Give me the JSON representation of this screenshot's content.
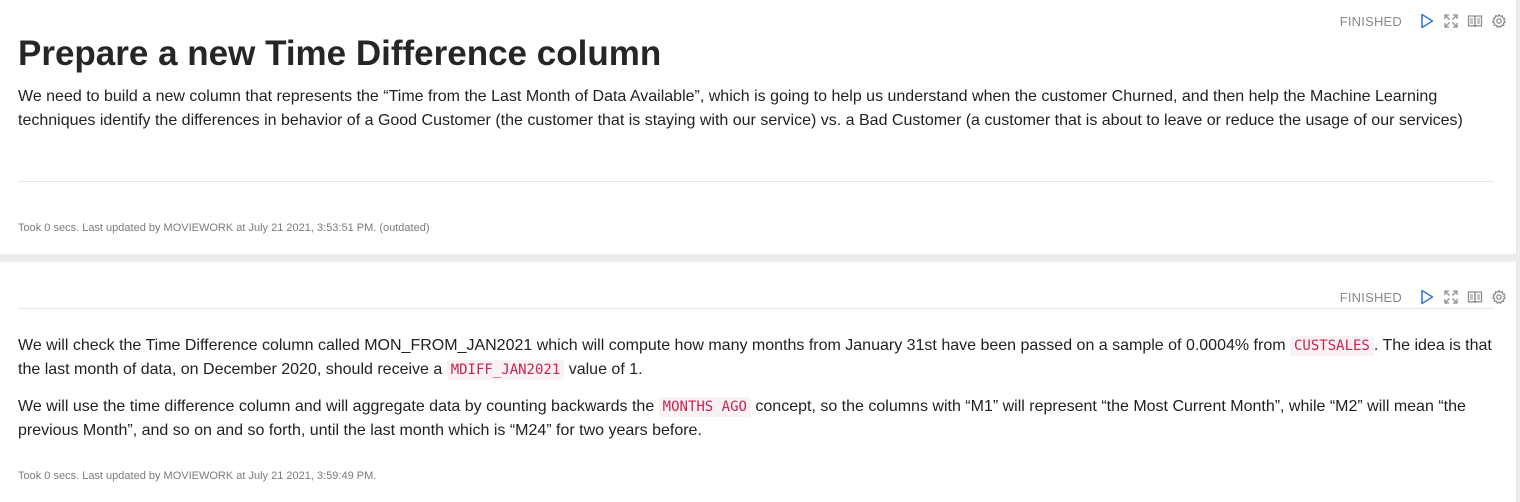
{
  "paragraph1": {
    "status": "FINISHED",
    "title": "Prepare a new Time Difference column",
    "text": "We need to build a new column that represents the “Time from the Last Month of Data Available”, which is going to help us understand when the customer Churned, and then help the Machine Learning techniques identify the differences in behavior of a Good Customer (the customer that is staying with our service) vs. a Bad Customer (a customer that is about to leave or reduce the usage of our services)",
    "footer": "Took 0 secs. Last updated by MOVIEWORK at July 21 2021, 3:53:51 PM. (outdated)",
    "icons": [
      "run-icon",
      "expand-icon",
      "book-icon",
      "settings-icon"
    ]
  },
  "paragraph2": {
    "status": "FINISHED",
    "text1_part1": "We will check the Time Difference column called MON_FROM_JAN2021 which will compute how many months from January 31st have been passed on a sample of 0.0004% from ",
    "text1_code1": "CUSTSALES",
    "text1_part2": ". The idea is that the last month of data, on December 2020, should receive a ",
    "text1_code2": "MDIFF_JAN2021",
    "text1_part3": " value of 1.",
    "text2_part1": "We will use the time difference column and will aggregate data by counting backwards the ",
    "text2_code1": "MONTHS AGO",
    "text2_part2": " concept, so the columns with “M1” will represent “the Most Current Month”, while “M2” will mean “the previous Month”, and so on and so forth, until the last month which is “M24” for two years before.",
    "footer": "Took 0 secs. Last updated by MOVIEWORK at July 21 2021, 3:59:49 PM.",
    "icons": [
      "run-icon",
      "expand-icon",
      "book-icon",
      "settings-icon"
    ]
  },
  "colors": {
    "accent": "#3a7bd5",
    "code_text": "#c7254e",
    "code_bg": "#f9f2f4",
    "muted": "#8a8a8a"
  }
}
